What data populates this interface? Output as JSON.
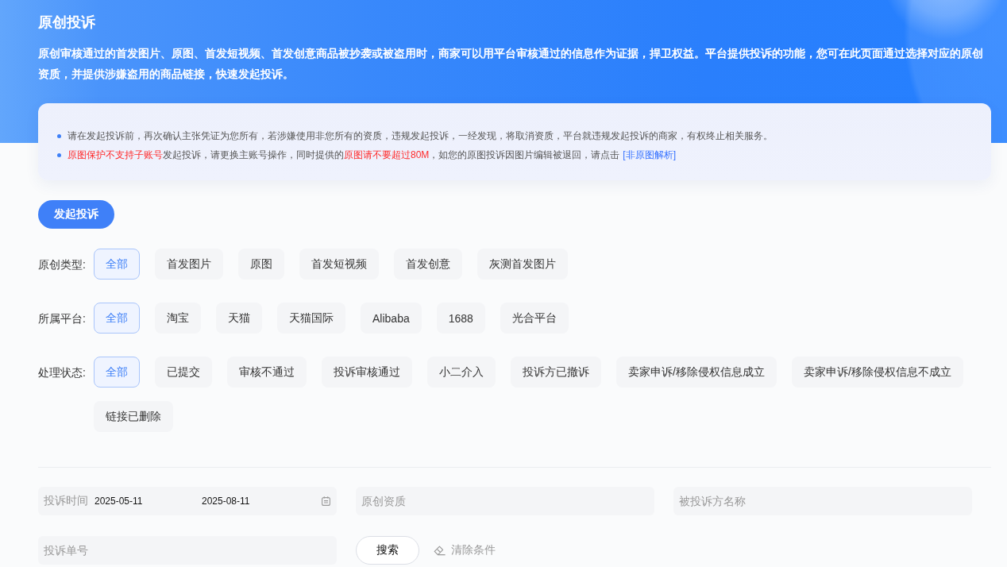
{
  "header": {
    "title": "原创投诉",
    "description": "原创审核通过的首发图片、原图、首发短视频、首发创意商品被抄袭或被盗用时，商家可以用平台审核通过的信息作为证据，捍卫权益。平台提供投诉的功能，您可在此页面通过选择对应的原创资质，并提供涉嫌盗用的商品链接，快速发起投诉。"
  },
  "notice": {
    "items": [
      {
        "segments": [
          {
            "kind": "plain",
            "text": "请在发起投诉前，再次确认主张凭证为您所有，若涉嫌使用非您所有的资质，违规发起投诉，一经发现，将取消资质，平台就违规发起投诉的商家，有权终止相关服务。"
          }
        ]
      },
      {
        "segments": [
          {
            "kind": "warning",
            "text": "原图保护不支持子账号"
          },
          {
            "kind": "plain",
            "text": "发起投诉，请更换主账号操作，同时提供的"
          },
          {
            "kind": "warning",
            "text": "原图请不要超过80M"
          },
          {
            "kind": "plain",
            "text": "，如您的原图投诉因图片编辑被退回，请点击"
          },
          {
            "kind": "link",
            "text": "[非原图解析]"
          }
        ]
      }
    ]
  },
  "start_button": {
    "label": "发起投诉"
  },
  "filters": [
    {
      "label": "原创类型:",
      "options": [
        {
          "label": "全部",
          "selected": true
        },
        {
          "label": "首发图片",
          "selected": false
        },
        {
          "label": "原图",
          "selected": false
        },
        {
          "label": "首发短视频",
          "selected": false
        },
        {
          "label": "首发创意",
          "selected": false
        },
        {
          "label": "灰测首发图片",
          "selected": false
        }
      ]
    },
    {
      "label": "所属平台:",
      "options": [
        {
          "label": "全部",
          "selected": true
        },
        {
          "label": "淘宝",
          "selected": false
        },
        {
          "label": "天猫",
          "selected": false
        },
        {
          "label": "天猫国际",
          "selected": false
        },
        {
          "label": "Alibaba",
          "selected": false
        },
        {
          "label": "1688",
          "selected": false
        },
        {
          "label": "光合平台",
          "selected": false
        }
      ]
    },
    {
      "label": "处理状态:",
      "options": [
        {
          "label": "全部",
          "selected": true
        },
        {
          "label": "已提交",
          "selected": false
        },
        {
          "label": "审核不通过",
          "selected": false
        },
        {
          "label": "投诉审核通过",
          "selected": false
        },
        {
          "label": "小二介入",
          "selected": false
        },
        {
          "label": "投诉方已撤诉",
          "selected": false
        },
        {
          "label": "卖家申诉/移除侵权信息成立",
          "selected": false
        },
        {
          "label": "卖家申诉/移除侵权信息不成立",
          "selected": false
        },
        {
          "label": "链接已删除",
          "selected": false
        }
      ]
    }
  ],
  "search_form": {
    "fields": [
      {
        "kind": "date_range",
        "label": "投诉时间",
        "start": "2025-05-11",
        "end": "2025-08-11"
      },
      {
        "kind": "text",
        "placeholder": "原创资质"
      },
      {
        "kind": "text",
        "placeholder": "被投诉方名称"
      },
      {
        "kind": "text",
        "placeholder": "投诉单号"
      }
    ],
    "search_button": "搜索",
    "clear_button": "清除条件"
  }
}
